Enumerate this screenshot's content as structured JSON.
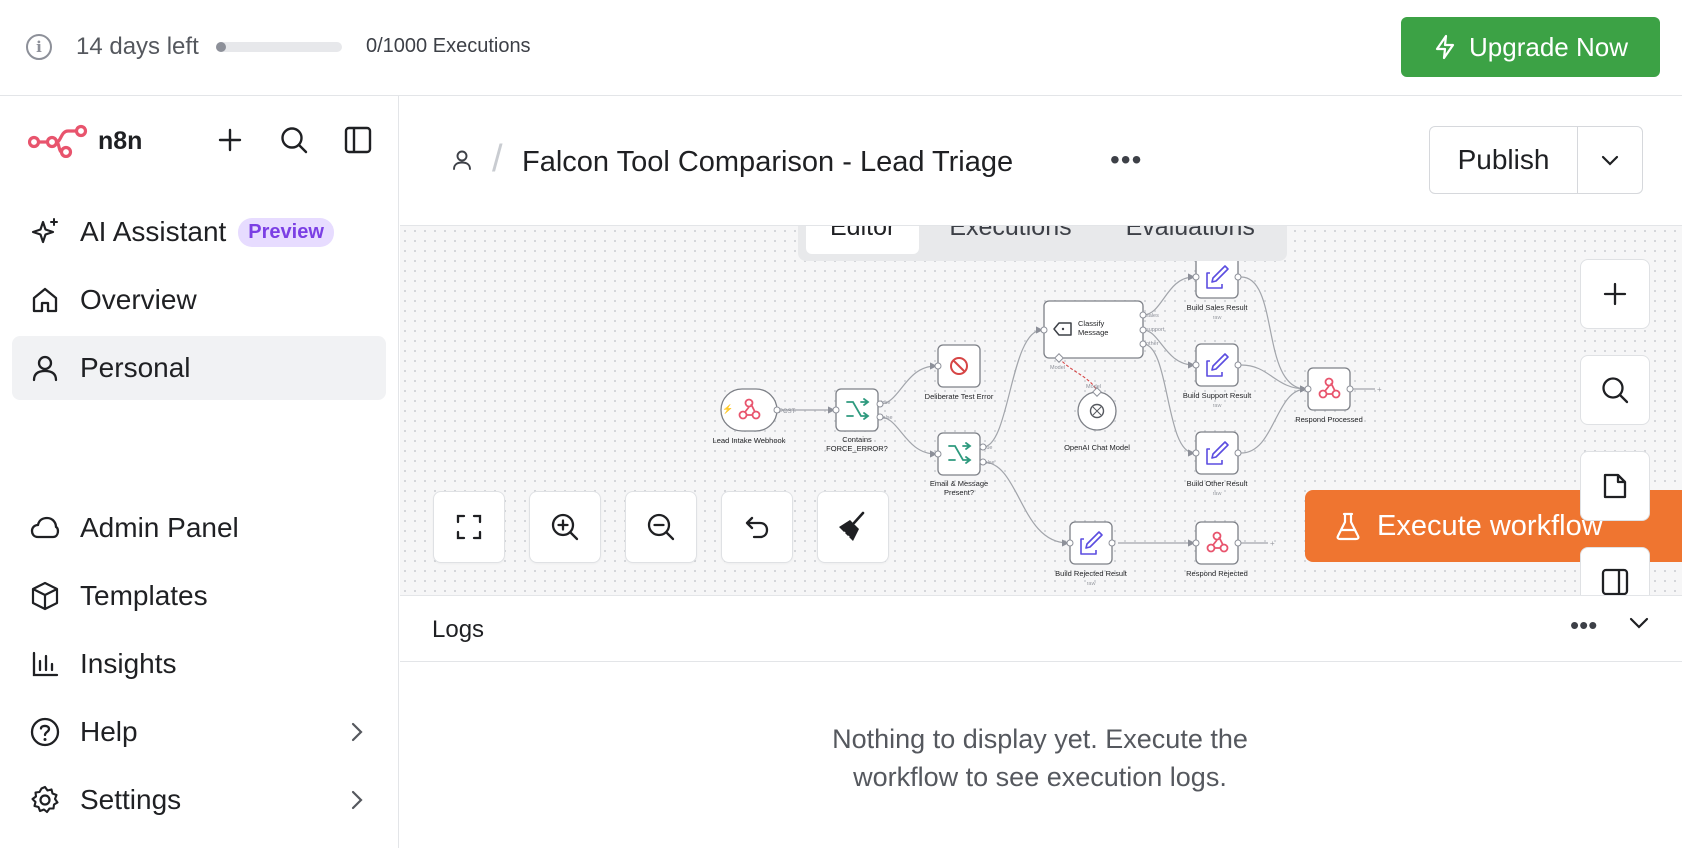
{
  "trial": {
    "days_left": "14 days left",
    "executions": "0/1000 Executions",
    "usage_fraction": 0.0,
    "upgrade_label": "Upgrade Now",
    "upgrade_color": "#3ca245"
  },
  "brand": {
    "name": "n8n",
    "color": "#e8546d"
  },
  "sidebar": {
    "top_items": [
      {
        "label": "AI Assistant",
        "badge": "Preview",
        "icon": "sparkles-icon"
      },
      {
        "label": "Overview",
        "icon": "home-icon"
      },
      {
        "label": "Personal",
        "icon": "user-icon",
        "active": true
      }
    ],
    "bottom_items": [
      {
        "label": "Admin Panel",
        "icon": "cloud-icon"
      },
      {
        "label": "Templates",
        "icon": "box-icon"
      },
      {
        "label": "Insights",
        "icon": "bar-chart-icon"
      },
      {
        "label": "Help",
        "icon": "help-circle-icon",
        "has_submenu": true
      },
      {
        "label": "Settings",
        "icon": "gear-icon",
        "has_submenu": true
      }
    ]
  },
  "header": {
    "workflow_title": "Falcon Tool Comparison - Lead Triage",
    "publish_label": "Publish",
    "tabs": [
      "Editor",
      "Executions",
      "Evaluations"
    ],
    "active_tab": "Editor"
  },
  "canvas": {
    "execute_label": "Execute workflow",
    "execute_color": "#ef7530",
    "nodes": {
      "webhook": "Lead Intake Webhook",
      "webhook_method": "POST",
      "if1_line1": "Contains",
      "if1_line2": "FORCE_ERROR?",
      "error": "Deliberate Test Error",
      "if2_line1": "Email & Message",
      "if2_line2": "Present?",
      "classify_line1": "Classify",
      "classify_line2": "Message",
      "model": "OpenAI Chat Model",
      "model_port": "Model",
      "sales": "Build Sales Result",
      "support": "Build Support Result",
      "other": "Build Other Result",
      "rejected": "Build Rejected Result",
      "respond_processed": "Respond Processed",
      "respond_rejected": "Respond Rejected",
      "raw": "raw",
      "true_label": "true",
      "false_label": "false",
      "sales_port": "sales",
      "support_port": "support",
      "other_port": "other"
    }
  },
  "logs": {
    "title": "Logs",
    "empty_line1": "Nothing to display yet. Execute the",
    "empty_line2": "workflow to see execution logs."
  }
}
